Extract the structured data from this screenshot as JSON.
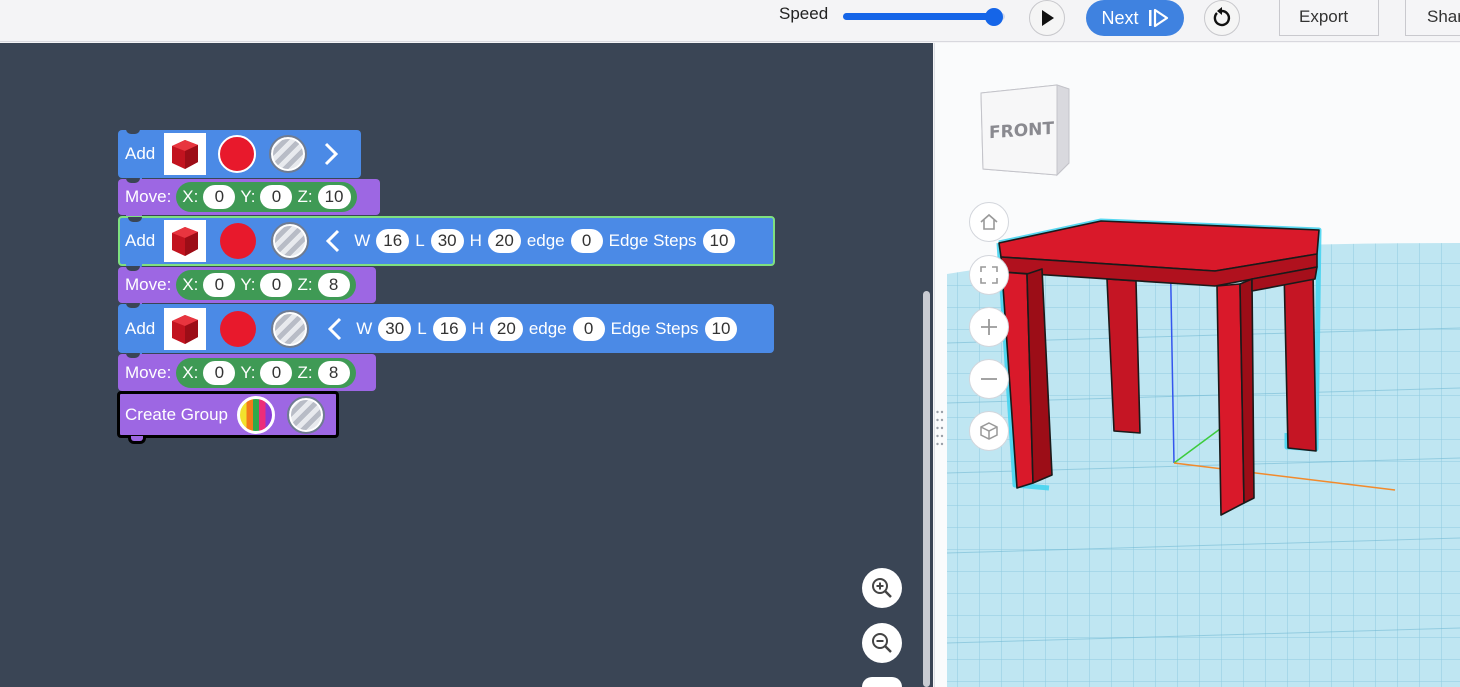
{
  "toolbar": {
    "speed_label": "Speed",
    "speed_value": 0.93,
    "next_label": "Next",
    "export_label": "Export",
    "share_label": "Shar"
  },
  "blocks": {
    "add1": {
      "label": "Add"
    },
    "move1": {
      "label": "Move:",
      "x_label": "X:",
      "x": "0",
      "y_label": "Y:",
      "y": "0",
      "z_label": "Z:",
      "z": "10"
    },
    "add2": {
      "label": "Add",
      "w_label": "W",
      "w": "16",
      "l_label": "L",
      "l": "30",
      "h_label": "H",
      "h": "20",
      "edge_label": "edge",
      "edge": "0",
      "steps_label": "Edge Steps",
      "steps": "10"
    },
    "move2": {
      "label": "Move:",
      "x_label": "X:",
      "x": "0",
      "y_label": "Y:",
      "y": "0",
      "z_label": "Z:",
      "z": "8"
    },
    "add3": {
      "label": "Add",
      "w_label": "W",
      "w": "30",
      "l_label": "L",
      "l": "16",
      "h_label": "H",
      "h": "20",
      "edge_label": "edge",
      "edge": "0",
      "steps_label": "Edge Steps",
      "steps": "10"
    },
    "move3": {
      "label": "Move:",
      "x_label": "X:",
      "x": "0",
      "y_label": "Y:",
      "y": "0",
      "z_label": "Z:",
      "z": "8"
    },
    "group": {
      "label": "Create Group"
    }
  },
  "viewcube": {
    "front_label": "FRONT"
  },
  "colors": {
    "shape_red": "#e8192c",
    "block_blue": "#4b8ae6",
    "block_purple": "#9d67e3",
    "block_green": "#3f9a55",
    "workspace": "#3a4555",
    "selection": "#7fe07f"
  },
  "icons": [
    "play-icon",
    "next-step-icon",
    "reset-icon",
    "zoom-in-icon",
    "zoom-out-icon",
    "home-icon",
    "fit-icon",
    "plus-icon",
    "minus-icon",
    "perspective-icon",
    "cube-icon",
    "chevron-right-icon",
    "chevron-left-icon"
  ]
}
